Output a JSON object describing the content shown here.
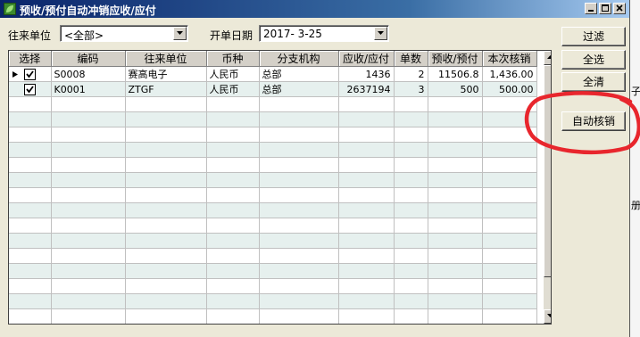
{
  "window": {
    "title": "预收/预付自动冲销应收/应付",
    "icon": "app-leaf-icon",
    "controls": [
      "minimize-icon",
      "maximize-icon",
      "close-icon"
    ]
  },
  "filters": {
    "partner_label": "往来单位",
    "partner_value": "<全部>",
    "date_label": "开单日期",
    "date_value": "2017- 3-25"
  },
  "buttons": {
    "filter": "过滤",
    "select_all": "全选",
    "clear_all": "全清",
    "auto_writeoff": "自动核销"
  },
  "grid": {
    "columns": [
      "选择",
      "编码",
      "往来单位",
      "币种",
      "分支机构",
      "应收/应付",
      "单数",
      "预收/预付",
      "本次核销"
    ],
    "rows": [
      {
        "selected": true,
        "code": "S0008",
        "partner": "赛高电子",
        "currency": "人民币",
        "branch": "总部",
        "receivable": "1436",
        "count": "2",
        "prepaid": "11506.8",
        "writeoff": "1,436.00"
      },
      {
        "selected": true,
        "code": "K0001",
        "partner": "ZTGF",
        "currency": "人民币",
        "branch": "总部",
        "receivable": "2637194",
        "count": "3",
        "prepaid": "500",
        "writeoff": "500.00"
      }
    ]
  },
  "edge_fragments": [
    "子",
    "册"
  ],
  "annotation": {
    "shape": "ellipse",
    "color": "#e8262d"
  }
}
